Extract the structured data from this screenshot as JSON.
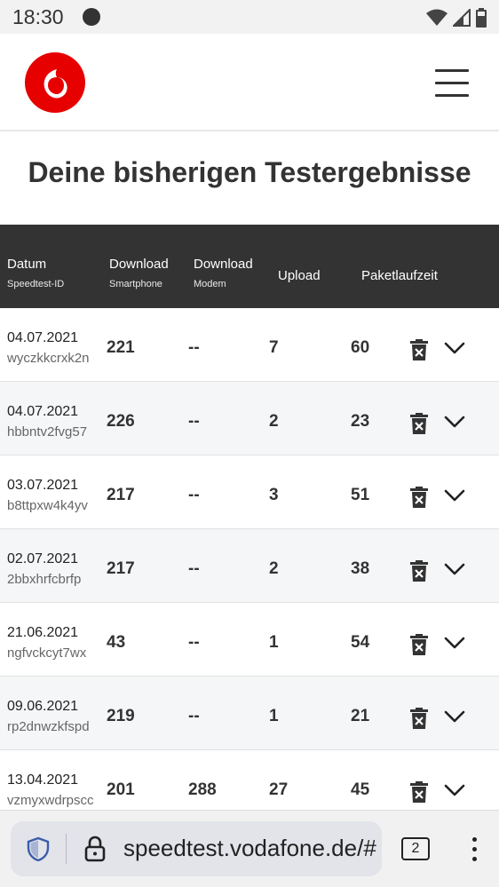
{
  "status_bar": {
    "time": "18:30"
  },
  "page": {
    "title": "Deine bisherigen Testergebnisse"
  },
  "table": {
    "headers": {
      "date": "Datum",
      "date_sub": "Speedtest-ID",
      "dl_phone": "Download",
      "dl_phone_sub": "Smartphone",
      "dl_modem": "Download",
      "dl_modem_sub": "Modem",
      "upload": "Upload",
      "latency": "Paketlaufzeit"
    },
    "rows": [
      {
        "date": "04.07.2021",
        "id": "wyczkkcrxk2n",
        "dl_phone": "221",
        "dl_modem": "--",
        "upload": "7",
        "latency": "60"
      },
      {
        "date": "04.07.2021",
        "id": "hbbntv2fvg57",
        "dl_phone": "226",
        "dl_modem": "--",
        "upload": "2",
        "latency": "23"
      },
      {
        "date": "03.07.2021",
        "id": "b8ttpxw4k4yv",
        "dl_phone": "217",
        "dl_modem": "--",
        "upload": "3",
        "latency": "51"
      },
      {
        "date": "02.07.2021",
        "id": "2bbxhrfcbrfp",
        "dl_phone": "217",
        "dl_modem": "--",
        "upload": "2",
        "latency": "38"
      },
      {
        "date": "21.06.2021",
        "id": "ngfvckcyt7wx",
        "dl_phone": "43",
        "dl_modem": "--",
        "upload": "1",
        "latency": "54"
      },
      {
        "date": "09.06.2021",
        "id": "rp2dnwzkfspd",
        "dl_phone": "219",
        "dl_modem": "--",
        "upload": "1",
        "latency": "21"
      },
      {
        "date": "13.04.2021",
        "id": "vzmyxwdrpscc",
        "dl_phone": "201",
        "dl_modem": "288",
        "upload": "27",
        "latency": "45"
      }
    ]
  },
  "browser": {
    "url": "speedtest.vodafone.de/#",
    "tab_count": "2"
  },
  "icons": {
    "logo": "vodafone-logo",
    "menu": "hamburger-menu-icon",
    "delete": "trash-icon",
    "expand": "chevron-down-icon",
    "security": "shield-icon",
    "lock": "lock-icon",
    "more": "more-vertical-icon"
  },
  "colors": {
    "brand_red": "#e60000",
    "header_bg": "#333333",
    "row_alt": "#f4f6f8"
  }
}
